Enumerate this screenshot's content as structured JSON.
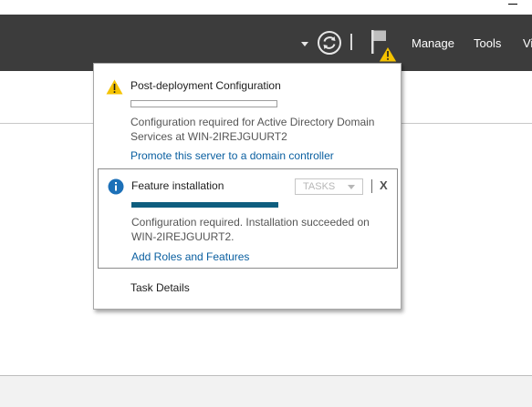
{
  "window": {
    "minimize_glyph": "—"
  },
  "header": {
    "menu": [
      {
        "label": "Manage"
      },
      {
        "label": "Tools"
      },
      {
        "label": "Vi"
      }
    ],
    "icons": {
      "dropdown": "chevron-down-icon",
      "refresh": "refresh-icon",
      "notifications": "flag-warning-icon"
    }
  },
  "notifications": [
    {
      "icon": "warning-icon",
      "title": "Post-deployment Configuration",
      "progress_percent": 0,
      "message_line1": "Configuration required for Active Directory Domain",
      "message_line2": "Services at WIN-2IREJGUURT2",
      "link": "Promote this server to a domain controller"
    },
    {
      "icon": "info-icon",
      "title": "Feature installation",
      "tasks_label": "TASKS",
      "close_label": "X",
      "progress_percent": 100,
      "message_line1": "Configuration required. Installation succeeded on",
      "message_line2": "WIN-2IREJGUURT2.",
      "link": "Add Roles and Features"
    }
  ],
  "task_details": "Task Details",
  "colors": {
    "header_bg": "#3c3c3c",
    "link": "#0a5fa0",
    "progress": "#0e5e7f",
    "warning": "#f5c300",
    "info": "#1c70b8"
  }
}
